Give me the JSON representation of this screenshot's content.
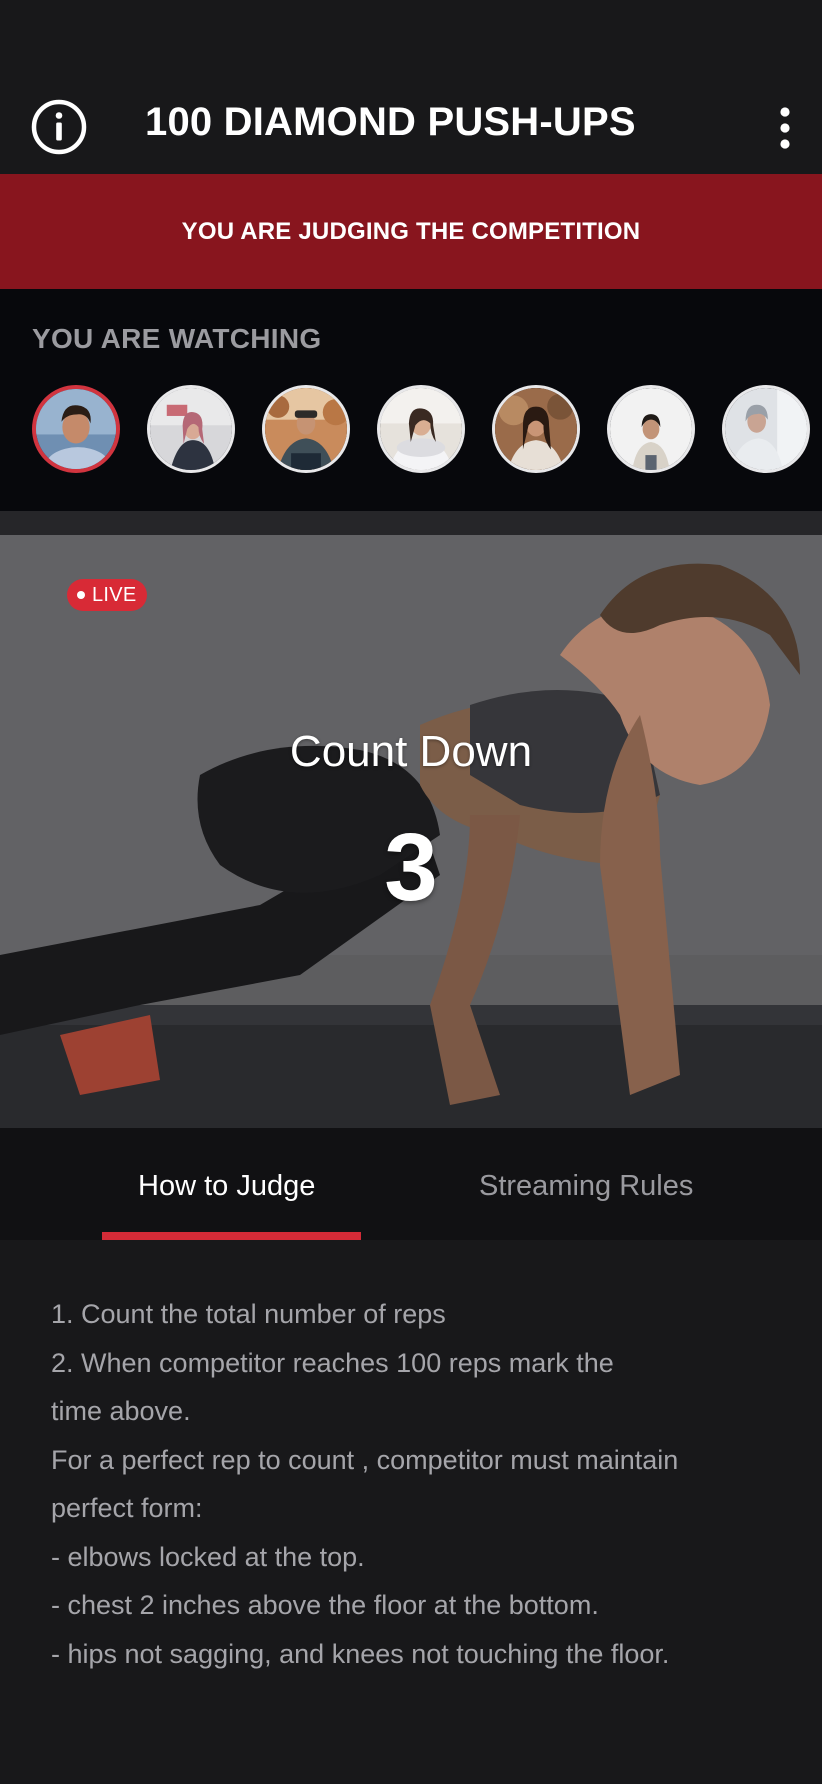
{
  "header": {
    "title": "100 DIAMOND PUSH-UPS",
    "info_icon": "info-circle-icon",
    "menu_icon": "more-vertical-icon"
  },
  "banner": {
    "text": "YOU ARE JUDGING THE COMPETITION",
    "color": "#88151e"
  },
  "watching": {
    "label": "YOU ARE WATCHING",
    "competitors": [
      {
        "name": "competitor-1",
        "active": true
      },
      {
        "name": "competitor-2",
        "active": false
      },
      {
        "name": "competitor-3",
        "active": false
      },
      {
        "name": "competitor-4",
        "active": false
      },
      {
        "name": "competitor-5",
        "active": false
      },
      {
        "name": "competitor-6",
        "active": false
      },
      {
        "name": "competitor-7",
        "active": false
      }
    ]
  },
  "video": {
    "live_label": "LIVE",
    "countdown_label": "Count Down",
    "countdown_value": "3"
  },
  "tabs": [
    {
      "label": "How to Judge",
      "active": true
    },
    {
      "label": "Streaming Rules",
      "active": false
    }
  ],
  "rules": [
    "1. Count the total number of reps",
    "2. When competitor reaches 100 reps mark the",
    "time above.",
    "For a perfect rep to count , competitor must maintain",
    "perfect form:",
    "- elbows locked at the top.",
    "- chest 2 inches above the floor at the bottom.",
    "- hips not sagging, and knees not touching the floor."
  ],
  "colors": {
    "accent": "#d42b37",
    "background": "#18181a"
  }
}
